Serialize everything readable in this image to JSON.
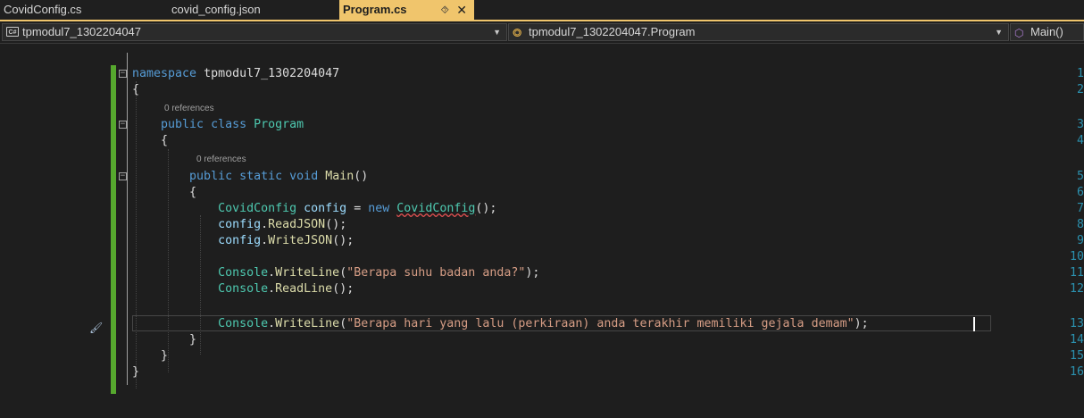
{
  "tabs": [
    {
      "label": "CovidConfig.cs",
      "active": false
    },
    {
      "label": "covid_config.json",
      "active": false
    },
    {
      "label": "Program.cs",
      "active": true,
      "pin_icon": "pin-icon",
      "close_icon": "close-icon"
    }
  ],
  "nav": {
    "project": "tpmodul7_1302204047",
    "class": "tpmodul7_1302204047.Program",
    "member": "Main()"
  },
  "editor": {
    "codelens": "0 references",
    "line_numbers": [
      "1",
      "2",
      "3",
      "4",
      "5",
      "6",
      "7",
      "8",
      "9",
      "10",
      "11",
      "12",
      "13",
      "14",
      "15",
      "16"
    ],
    "namespace_kw": "namespace",
    "namespace_name": "tpmodul7_1302204047",
    "public_kw": "public",
    "class_kw": "class",
    "class_name": "Program",
    "static_kw": "static",
    "void_kw": "void",
    "main_name": "Main",
    "parens": "()",
    "open_brace": "{",
    "close_brace": "}",
    "covidconfig_type": "CovidConfig",
    "config_var": "config",
    "assign": "=",
    "new_kw": "new",
    "ctor_end": "();",
    "dot": ".",
    "readjson": "ReadJSON",
    "writejson": "WriteJSON",
    "call_end": "();",
    "console": "Console",
    "writeline": "WriteLine",
    "readline": "ReadLine",
    "open_paren": "(",
    "str1": "\"Berapa suhu badan anda?\"",
    "str2": "\"Berapa hari yang lalu (perkiraan) anda terakhir memiliki gejala demam\"",
    "close_stmt": ");"
  },
  "colors": {
    "accent_tab": "#f0c56c",
    "change_bar": "#56a82e",
    "line_number": "#2b91af",
    "keyword": "#569cd6",
    "type": "#4ec9b0",
    "method": "#dcdcaa",
    "string": "#d69d85"
  }
}
